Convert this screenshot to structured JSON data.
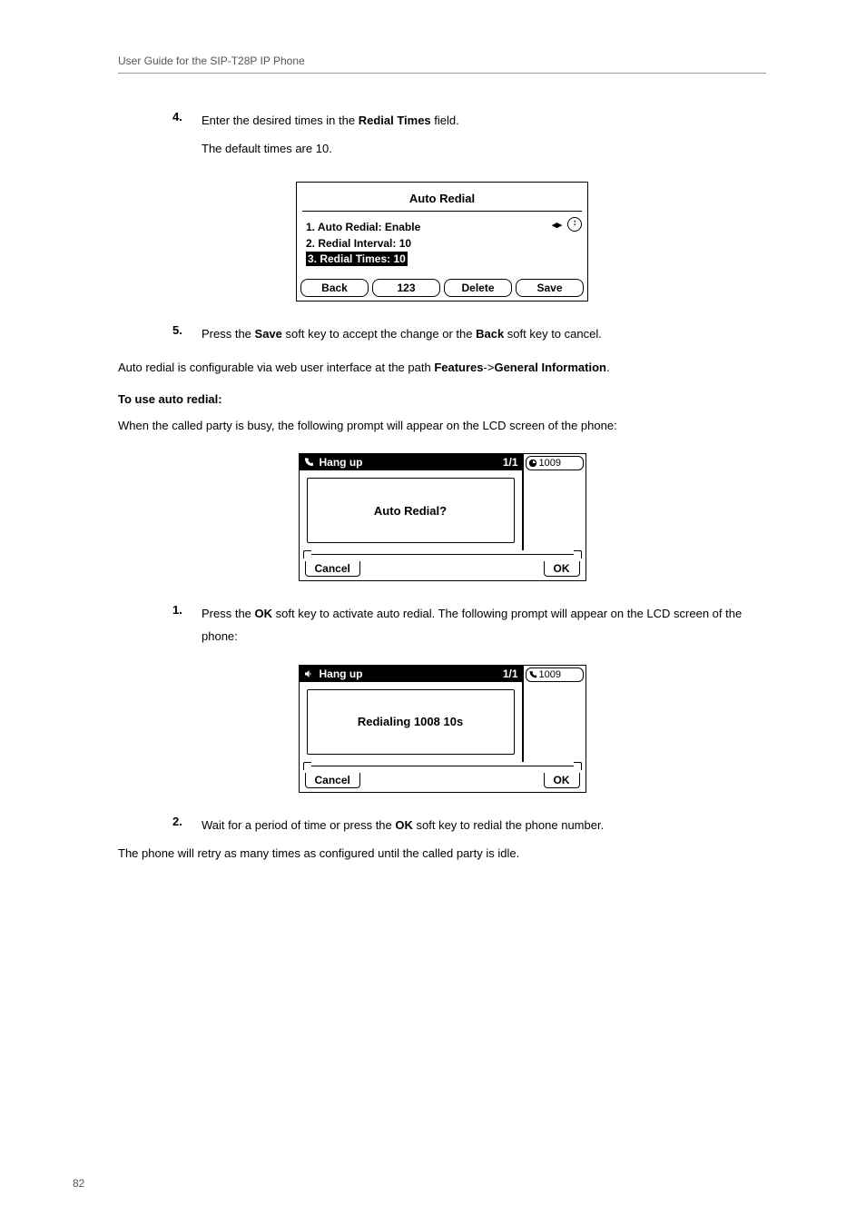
{
  "header": {
    "title": "User Guide for the SIP-T28P IP Phone"
  },
  "step4": {
    "num": "4.",
    "text_a": "Enter the desired times in the ",
    "text_b": "Redial Times",
    "text_c": " field.",
    "sub": "The default times are 10."
  },
  "lcd1": {
    "title": "Auto Redial",
    "row1": "1.  Auto Redial:      Enable",
    "row2": "2.  Redial Interval: 10",
    "row3": "3.  Redial Times:    10",
    "arrows": "◂▸",
    "scroll": "↕",
    "sk": [
      "Back",
      "123",
      "Delete",
      "Save"
    ]
  },
  "step5": {
    "num": "5.",
    "a": "Press the ",
    "b": "Save",
    "c": " soft key to accept the change or the ",
    "d": "Back",
    "e": " soft key to cancel."
  },
  "para_path": {
    "a": "Auto redial is configurable via web user interface at the path ",
    "b": "Features",
    "c": "->",
    "d": "General Information",
    "e": "."
  },
  "heading_use": "To use auto redial:",
  "para_busy": "When the called party is busy, the following prompt will appear on the LCD screen of the phone:",
  "lcd2": {
    "status_label": "Hang up",
    "status_count": "1/1",
    "side_line": "1009",
    "center": "Auto Redial?",
    "sk_left": "Cancel",
    "sk_right": "OK"
  },
  "step1b": {
    "num": "1.",
    "a": "Press the ",
    "b": "OK",
    "c": " soft key to activate auto redial. The following prompt will appear on the LCD screen of the phone:"
  },
  "lcd3": {
    "status_label": "Hang up",
    "status_count": "1/1",
    "side_line": "1009",
    "center": "Redialing 1008 10s",
    "sk_left": "Cancel",
    "sk_right": "OK"
  },
  "step2b": {
    "num": "2.",
    "a": "Wait for a period of time or press the ",
    "b": "OK",
    "c": " soft key to redial the phone number."
  },
  "para_retry": "The phone will retry as many times as configured until the called party is idle.",
  "page_num": "82"
}
